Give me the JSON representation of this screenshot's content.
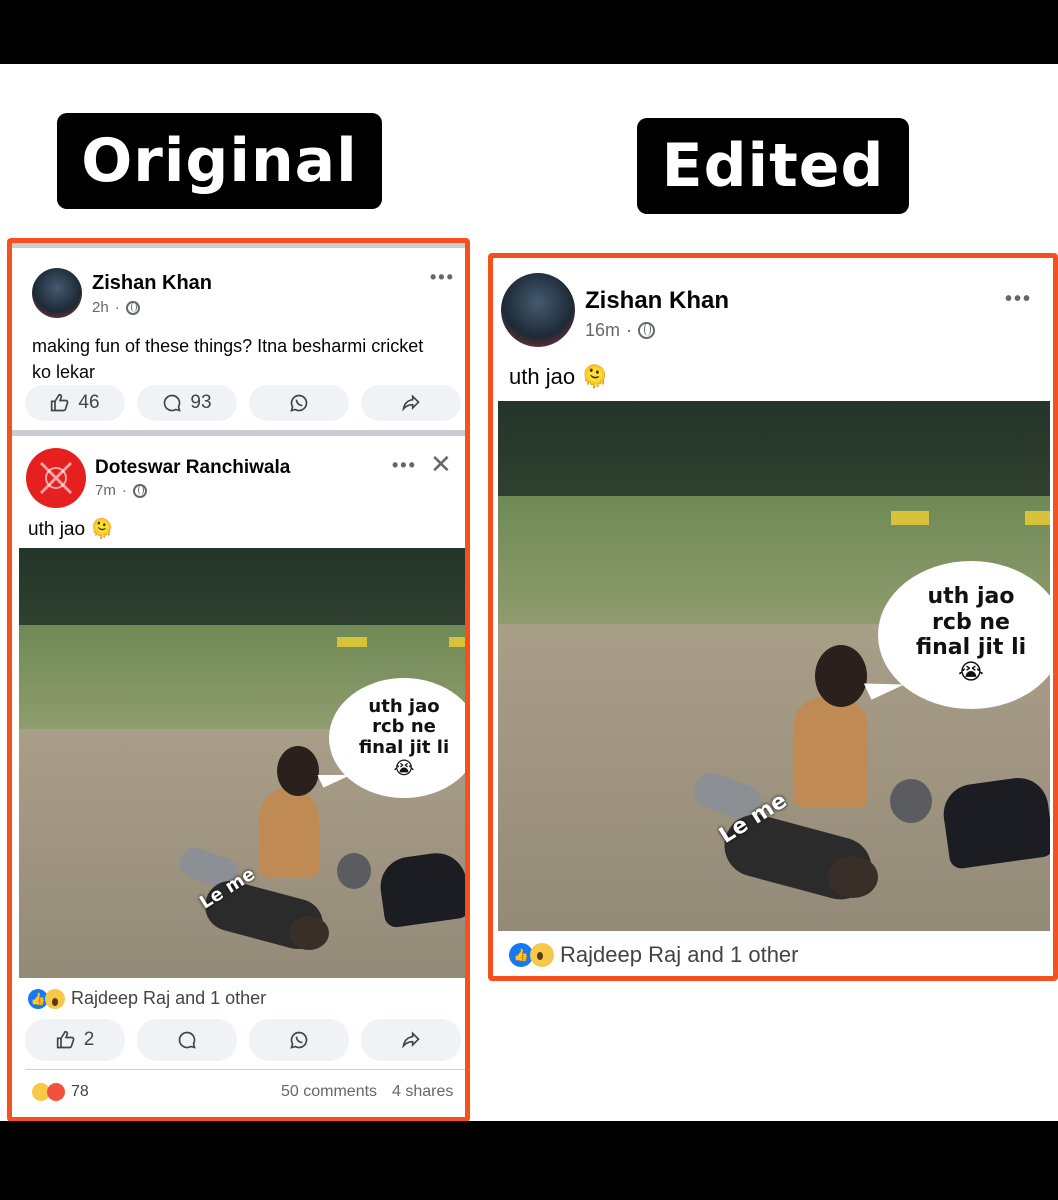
{
  "labels": {
    "original": "Original",
    "edited": "Edited"
  },
  "left": {
    "post1": {
      "author": "Zishan Khan",
      "time": "2h",
      "text": "making fun of these things? Itna besharmi cricket ko lekar",
      "likes": "46",
      "comments": "93"
    },
    "post2": {
      "author": "Doteswar Ranchiwala",
      "time": "7m",
      "text": "uth jao 🫠",
      "bubble": [
        "uth jao",
        "rcb ne",
        "final jit li",
        "😭"
      ],
      "overlay": "Le me",
      "reactions_text": "Rajdeep Raj and 1 other",
      "likes": "2",
      "reaction_count": "78",
      "comments_count": "50 comments",
      "shares_count": "4 shares"
    }
  },
  "right": {
    "author": "Zishan Khan",
    "time": "16m",
    "text": "uth jao 🫠",
    "bubble": [
      "uth jao",
      "rcb ne",
      "final jit li",
      "😭"
    ],
    "overlay": "Le me",
    "reactions_text": "Rajdeep Raj and 1 other"
  },
  "icons": [
    "more-icon",
    "globe-icon",
    "close-icon",
    "like-icon",
    "comment-icon",
    "whatsapp-icon",
    "share-icon"
  ],
  "colors": {
    "frame": "#f4511e",
    "facebook_blue": "#1877f2",
    "meta_gray": "#65676b"
  }
}
